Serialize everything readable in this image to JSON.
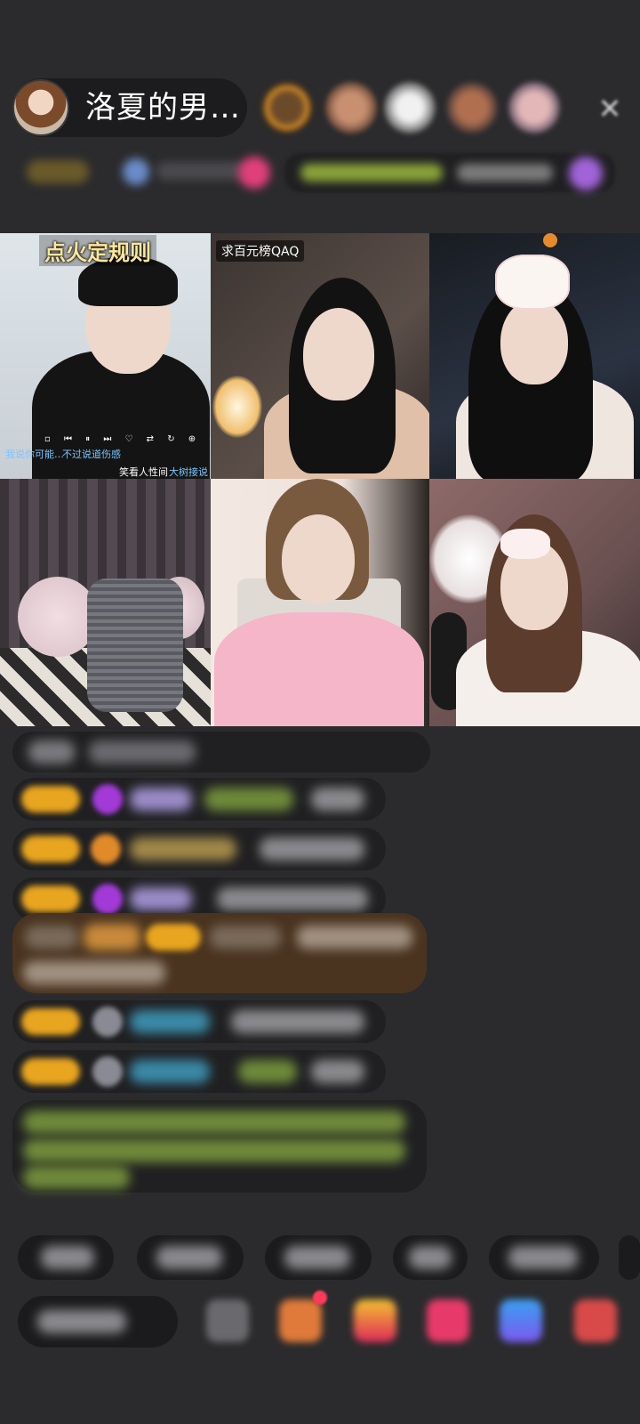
{
  "header": {
    "anchor_name": "洛夏的男…",
    "close_icon": "close-icon"
  },
  "video_grid": {
    "tiles": [
      {
        "title": "点火定规则"
      },
      {
        "tag": "求百元榜QAQ"
      },
      {},
      {},
      {},
      {}
    ],
    "tile1_overlay_left": "我说你可能…",
    "tile1_overlay_right": "不过说道伤感",
    "tile1_bottom_a": "笑看人性间",
    "tile1_bottom_b": "大树接说"
  },
  "colors": {
    "background": "#2b2b2d",
    "badge_gold": "#e8a51f",
    "title_yellow": "#ffe79a",
    "chat_highlight": "#6b4a22"
  }
}
